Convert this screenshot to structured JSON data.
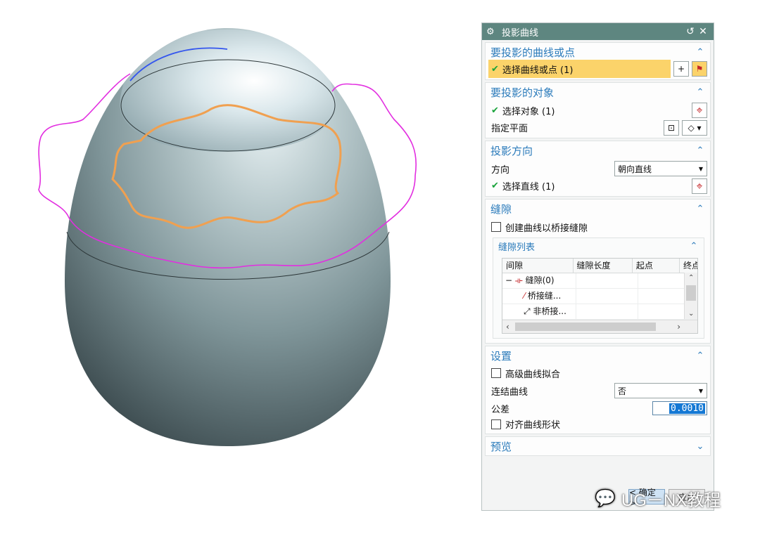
{
  "dialog": {
    "title": "投影曲线",
    "reset_icon": "reset-icon",
    "close_icon": "close-icon",
    "groups": {
      "curves": {
        "title": "要投影的曲线或点",
        "select_label": "选择曲线或点 (1)"
      },
      "objects": {
        "title": "要投影的对象",
        "select_label": "选择对象 (1)",
        "plane_label": "指定平面"
      },
      "direction": {
        "title": "投影方向",
        "direction_label": "方向",
        "direction_value": "朝向直线",
        "select_line_label": "选择直线 (1)"
      },
      "gap": {
        "title": "缝隙",
        "bridge_checkbox": "创建曲线以桥接缝隙",
        "list_title": "缝隙列表",
        "columns": [
          "间隙",
          "缝隙长度",
          "起点",
          "终点"
        ],
        "rows": [
          {
            "label": "缝隙(0)",
            "prefix": "−"
          },
          {
            "label": "桥接缝..."
          },
          {
            "label": "非桥接..."
          }
        ]
      },
      "settings": {
        "title": "设置",
        "advanced_fit": "高级曲线拟合",
        "join_label": "连结曲线",
        "join_value": "否",
        "tolerance_label": "公差",
        "tolerance_value": "0.0010",
        "align_shape": "对齐曲线形状"
      },
      "preview": {
        "title": "预览"
      }
    },
    "footer": {
      "ok": "< 确定 >",
      "apply": "应用"
    }
  },
  "watermark": {
    "text": "UG－NX教程"
  },
  "colors": {
    "titlebar": "#5e8680",
    "group_title": "#2b7bbb",
    "highlight": "#fbd36a",
    "check": "#19a33b",
    "projected_curve": "#f0a050",
    "projection_curve": "#e22ee0",
    "blue_curve": "#3355ee"
  }
}
